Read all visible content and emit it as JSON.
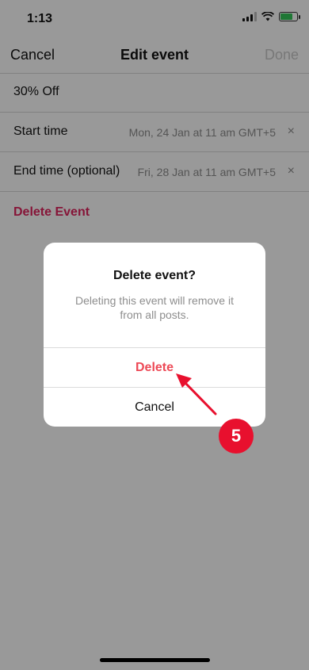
{
  "status_bar": {
    "time": "1:13"
  },
  "nav": {
    "cancel": "Cancel",
    "title": "Edit event",
    "done": "Done"
  },
  "form": {
    "event_name": "30% Off",
    "start": {
      "label": "Start time",
      "value": "Mon, 24 Jan at 11 am GMT+5",
      "clear": "×"
    },
    "end": {
      "label": "End time (optional)",
      "value": "Fri, 28 Jan at 11 am GMT+5",
      "clear": "×"
    },
    "delete_link": "Delete Event"
  },
  "dialog": {
    "title": "Delete event?",
    "message": "Deleting this event will remove it from all posts.",
    "delete_label": "Delete",
    "cancel_label": "Cancel"
  },
  "annotation": {
    "step": "5"
  },
  "colors": {
    "accent_red": "#ed4956",
    "badge_red": "#e8102e",
    "battery_green": "#34c759"
  }
}
